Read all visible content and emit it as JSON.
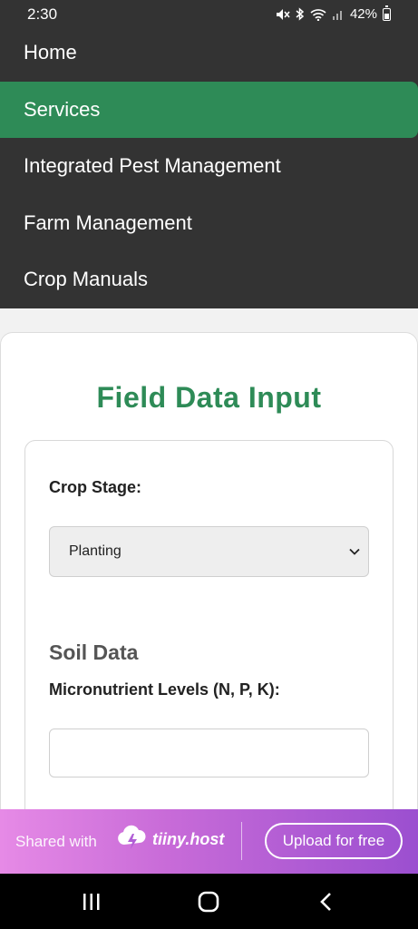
{
  "status_bar": {
    "time": "2:30",
    "battery_percent": "42%",
    "icons": [
      "mute-icon",
      "bluetooth-icon",
      "wifi-icon",
      "signal-icon",
      "battery-icon"
    ]
  },
  "nav": {
    "items": [
      {
        "label": "Home",
        "active": false
      },
      {
        "label": "Services",
        "active": true
      },
      {
        "label": "Integrated Pest Management",
        "active": false
      },
      {
        "label": "Farm Management",
        "active": false
      },
      {
        "label": "Crop Manuals",
        "active": false
      }
    ]
  },
  "form": {
    "title": "Field Data Input",
    "crop_stage_label": "Crop Stage:",
    "crop_stage_value": "Planting",
    "soil_section_title": "Soil Data",
    "micronutrient_label": "Micronutrient Levels (N, P, K):",
    "micronutrient_value": ""
  },
  "banner": {
    "shared_text": "Shared with",
    "brand": "tiiny.host",
    "upload_label": "Upload for free"
  },
  "colors": {
    "nav_bg": "#333333",
    "accent": "#2e8b57",
    "banner_start": "#e68ae6",
    "banner_end": "#9b4fd0"
  }
}
